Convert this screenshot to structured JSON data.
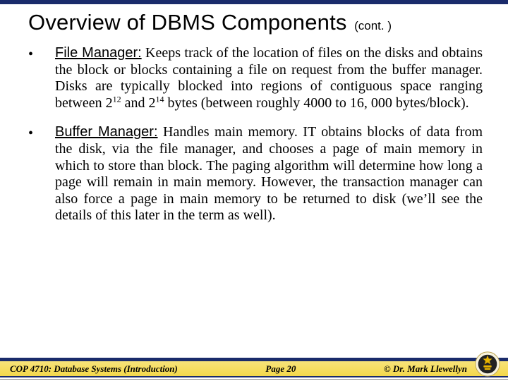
{
  "title": "Overview of DBMS Components",
  "title_cont": "(cont. )",
  "bullets": [
    {
      "mark": "•",
      "term": "File Manager:",
      "text_before_sup1": "  Keeps track of the location of files on the disks and obtains the block or blocks containing a file on request from the buffer manager.  Disks are typically blocked into regions of contiguous space ranging between 2",
      "sup1": "12",
      "mid": " and 2",
      "sup2": "14",
      "text_after_sup2": " bytes (between roughly 4000 to 16, 000 bytes/block)."
    },
    {
      "mark": "•",
      "term": "Buffer Manager:",
      "text": "  Handles main memory.  IT obtains blocks of data from the disk, via the file manager, and chooses a page of main memory in which to store than block.  The paging algorithm will determine how long a page will remain in main memory.  However, the transaction manager can also force a page in main memory to be returned to disk (we’ll see the details of this later in the term as well)."
    }
  ],
  "footer": {
    "left": "COP 4710: Database Systems  (Introduction)",
    "center": "Page 20",
    "right": "©  Dr. Mark Llewellyn"
  }
}
